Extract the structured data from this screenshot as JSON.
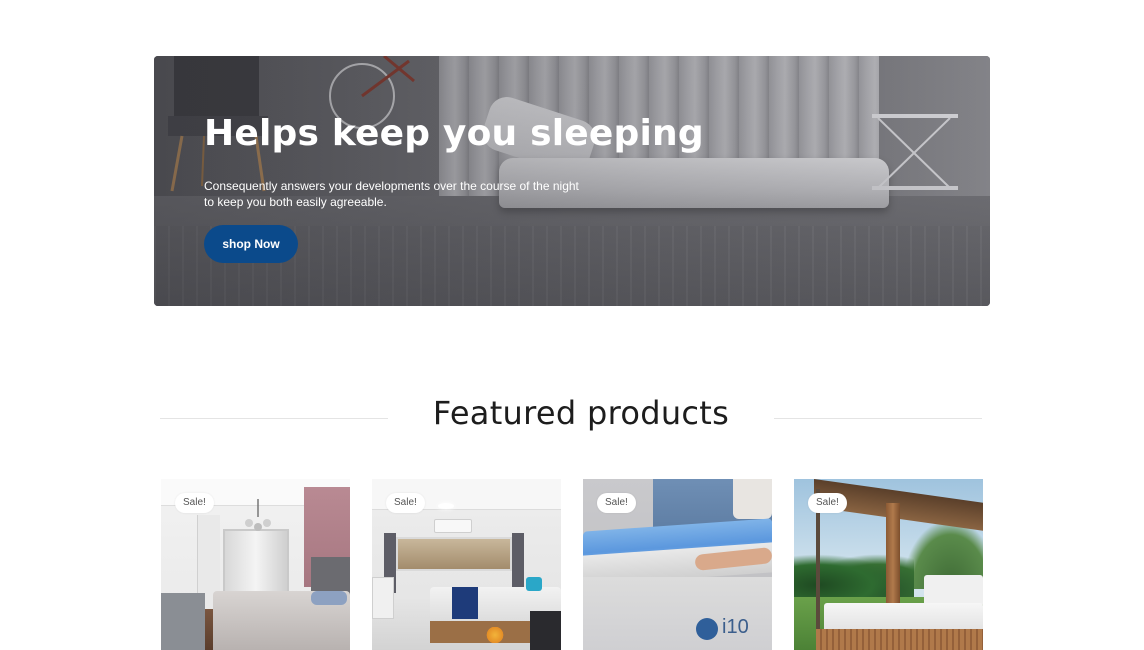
{
  "hero": {
    "title": "Helps keep you sleeping",
    "text": "Consequently answers your developments over the course of the night to keep you both easily agreeable.",
    "button_label": "shop Now",
    "button_color": "#0b4a8b"
  },
  "featured": {
    "title": "Featured products",
    "products": [
      {
        "badge": "Sale!",
        "image_icon": "bedroom-photo"
      },
      {
        "badge": "Sale!",
        "image_icon": "apartment-bedroom-photo"
      },
      {
        "badge": "Sale!",
        "image_icon": "mattress-topper-photo",
        "image_text": "i10"
      },
      {
        "badge": "Sale!",
        "image_icon": "outdoor-daybed-photo"
      }
    ]
  }
}
